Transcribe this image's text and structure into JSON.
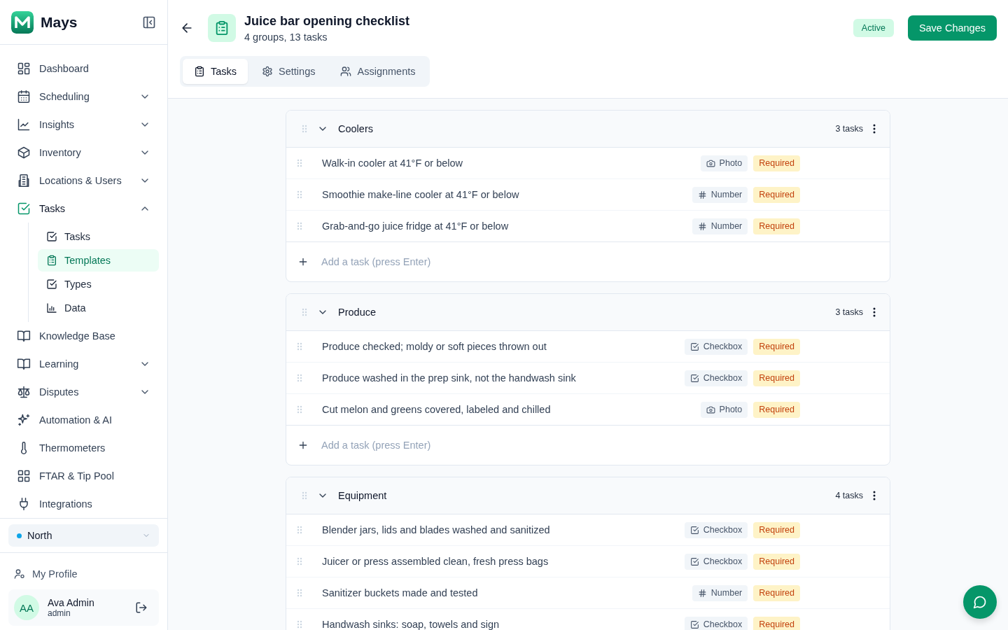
{
  "brand": {
    "name": "Mays"
  },
  "sidebar": {
    "items": [
      {
        "label": "Dashboard",
        "selected": false
      },
      {
        "label": "Scheduling",
        "selected": false,
        "expanded": false
      },
      {
        "label": "Insights",
        "selected": false,
        "expanded": false
      },
      {
        "label": "Inventory",
        "selected": false,
        "expanded": false
      },
      {
        "label": "Locations & Users",
        "selected": false,
        "expanded": false
      },
      {
        "label": "Tasks",
        "selected": true,
        "expanded": true,
        "children": [
          {
            "label": "Tasks",
            "selected": false
          },
          {
            "label": "Templates",
            "selected": true
          },
          {
            "label": "Types",
            "selected": false
          },
          {
            "label": "Data",
            "selected": false
          }
        ]
      },
      {
        "label": "Knowledge Base",
        "selected": false
      },
      {
        "label": "Learning",
        "selected": false,
        "expanded": false
      },
      {
        "label": "Disputes",
        "selected": false,
        "expanded": false
      },
      {
        "label": "Automation & AI",
        "selected": false
      },
      {
        "label": "Thermometers",
        "selected": false
      },
      {
        "label": "FTAR & Tip Pool",
        "selected": false
      },
      {
        "label": "Integrations",
        "selected": false
      }
    ],
    "location": {
      "name": "North",
      "color": "#0ea5e9"
    },
    "profile_link": "My Profile",
    "user": {
      "initials": "AA",
      "name": "Ava Admin",
      "role": "admin"
    }
  },
  "header": {
    "title": "Juice bar opening checklist",
    "subtitle": "4 groups, 13 tasks",
    "status": "Active",
    "save_button": "Save Changes"
  },
  "tabs": [
    {
      "label": "Tasks",
      "selected": true
    },
    {
      "label": "Settings",
      "selected": false
    },
    {
      "label": "Assignments",
      "selected": false
    }
  ],
  "groups": [
    {
      "name": "Coolers",
      "count": "3 tasks",
      "expanded": true,
      "add_placeholder": "Add a task (press Enter)",
      "tasks": [
        {
          "text": "Walk-in cooler at 41°F or below",
          "type": {
            "kind": "photo",
            "label": "Photo"
          },
          "badge": "Required"
        },
        {
          "text": "Smoothie make-line cooler at 41°F or below",
          "type": {
            "kind": "number",
            "label": "Number"
          },
          "badge": "Required"
        },
        {
          "text": "Grab-and-go juice fridge at 41°F or below",
          "type": {
            "kind": "number",
            "label": "Number"
          },
          "badge": "Required"
        }
      ]
    },
    {
      "name": "Produce",
      "count": "3 tasks",
      "expanded": true,
      "add_placeholder": "Add a task (press Enter)",
      "tasks": [
        {
          "text": "Produce checked; moldy or soft pieces thrown out",
          "type": {
            "kind": "checkbox",
            "label": "Checkbox"
          },
          "badge": "Required"
        },
        {
          "text": "Produce washed in the prep sink, not the handwash sink",
          "type": {
            "kind": "checkbox",
            "label": "Checkbox"
          },
          "badge": "Required"
        },
        {
          "text": "Cut melon and greens covered, labeled and chilled",
          "type": {
            "kind": "photo",
            "label": "Photo"
          },
          "badge": "Required"
        }
      ]
    },
    {
      "name": "Equipment",
      "count": "4 tasks",
      "expanded": true,
      "tasks": [
        {
          "text": "Blender jars, lids and blades washed and sanitized",
          "type": {
            "kind": "checkbox",
            "label": "Checkbox"
          },
          "badge": "Required"
        },
        {
          "text": "Juicer or press assembled clean, fresh press bags",
          "type": {
            "kind": "checkbox",
            "label": "Checkbox"
          },
          "badge": "Required"
        },
        {
          "text": "Sanitizer buckets made and tested",
          "type": {
            "kind": "number",
            "label": "Number"
          },
          "badge": "Required"
        },
        {
          "text": "Handwash sinks: soap, towels and sign",
          "type": {
            "kind": "checkbox",
            "label": "Checkbox"
          },
          "badge": "Required"
        }
      ]
    }
  ]
}
